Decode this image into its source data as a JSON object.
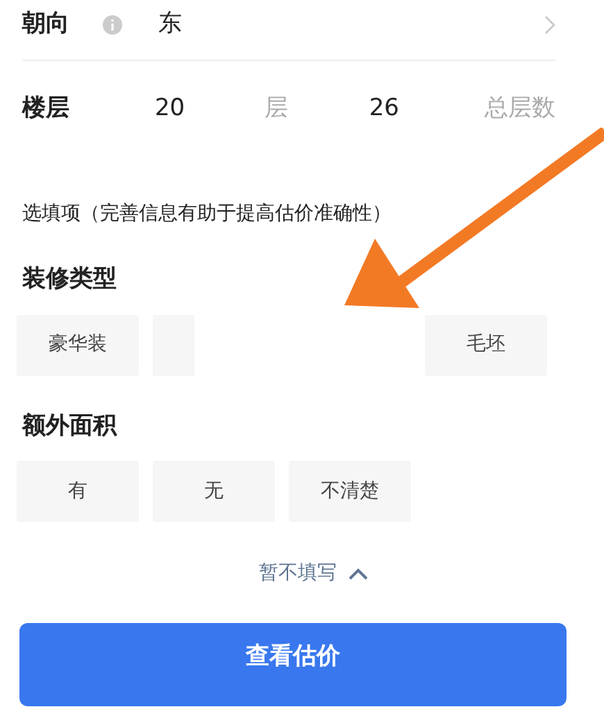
{
  "fields": [
    {
      "kind": "select",
      "label": "朝向",
      "info": true,
      "value": "东"
    },
    {
      "kind": "floor",
      "label": "楼层",
      "floor": "20",
      "floor_unit": "层",
      "total": "26",
      "total_unit": "总层数"
    }
  ],
  "optional_hint": "选填项（完善信息有助于提高估价准确性）",
  "groups": [
    {
      "title": "装修类型",
      "options": [
        {
          "kind": "option",
          "label": "豪华装"
        },
        {
          "kind": "covered"
        },
        {
          "kind": "option",
          "label": "毛坯"
        }
      ]
    },
    {
      "title": "额外面积",
      "options": [
        {
          "kind": "option",
          "label": "有"
        },
        {
          "kind": "option",
          "label": "无"
        },
        {
          "kind": "option",
          "label": "不清楚"
        }
      ]
    }
  ],
  "collapse": {
    "label": "暂不填写",
    "expanded": true
  },
  "submit": "查看估价",
  "annotation": {
    "kind": "arrow"
  }
}
